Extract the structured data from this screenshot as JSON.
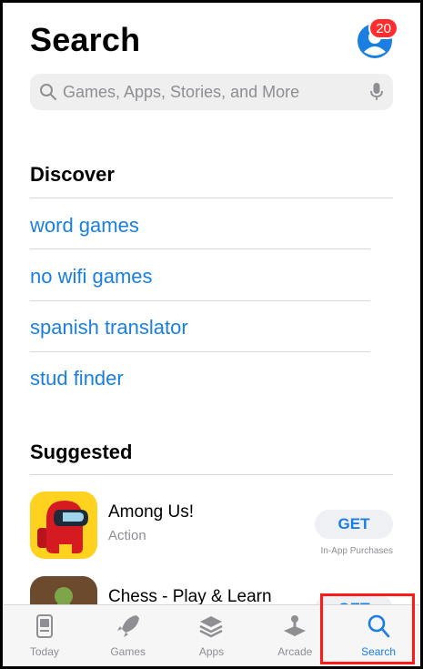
{
  "header": {
    "title": "Search",
    "badge_count": "20"
  },
  "search": {
    "placeholder": "Games, Apps, Stories, and More"
  },
  "discover": {
    "title": "Discover",
    "items": [
      "word games",
      "no wifi games",
      "spanish translator",
      "stud finder"
    ]
  },
  "suggested": {
    "title": "Suggested",
    "apps": [
      {
        "name": "Among Us!",
        "category": "Action",
        "button": "GET",
        "note": "In-App Purchases"
      },
      {
        "name": "Chess - Play & Learn",
        "category": "",
        "button": "GET",
        "note": ""
      }
    ]
  },
  "tabbar": {
    "tabs": [
      {
        "label": "Today",
        "icon": "today-icon"
      },
      {
        "label": "Games",
        "icon": "rocket-icon"
      },
      {
        "label": "Apps",
        "icon": "layers-icon"
      },
      {
        "label": "Arcade",
        "icon": "joystick-icon"
      },
      {
        "label": "Search",
        "icon": "search-icon"
      }
    ],
    "active": "Search"
  },
  "colors": {
    "accent": "#1a7fe0",
    "badge": "#ff2d2d",
    "highlight": "#ff1a1a"
  }
}
